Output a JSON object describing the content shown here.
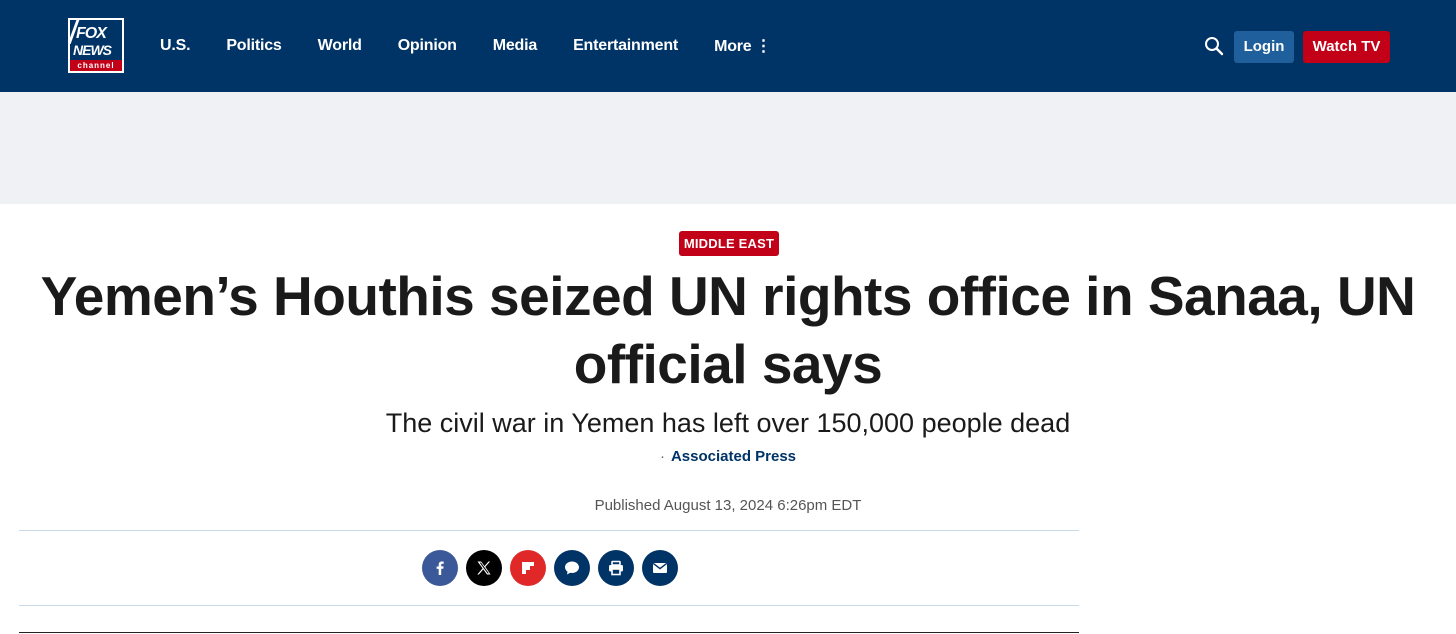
{
  "logo": {
    "line1": "FOX",
    "line2": "NEWS",
    "line3": "channel"
  },
  "nav": {
    "items": [
      "U.S.",
      "Politics",
      "World",
      "Opinion",
      "Media",
      "Entertainment"
    ],
    "more_label": "More",
    "more_icon": "⋮",
    "login_label": "Login",
    "watch_label": "Watch TV"
  },
  "article": {
    "category": "MIDDLE EAST",
    "headline": "Yemen’s Houthis seized UN rights office in Sanaa, UN official says",
    "subheadline": "The civil war in Yemen has left over 150,000 people dead",
    "byline_separator": "·",
    "author": "Associated Press",
    "published": "Published August 13, 2024 6:26pm EDT"
  },
  "share": [
    {
      "name": "facebook-icon",
      "color": "#3b5998"
    },
    {
      "name": "x-icon",
      "color": "#000000"
    },
    {
      "name": "flipboard-icon",
      "color": "#e12828"
    },
    {
      "name": "comment-icon",
      "color": "#003366"
    },
    {
      "name": "print-icon",
      "color": "#003366"
    },
    {
      "name": "email-icon",
      "color": "#003366"
    }
  ],
  "colors": {
    "nav_bg": "#003366",
    "accent_red": "#c20017",
    "login_blue": "#1f5f9b"
  }
}
